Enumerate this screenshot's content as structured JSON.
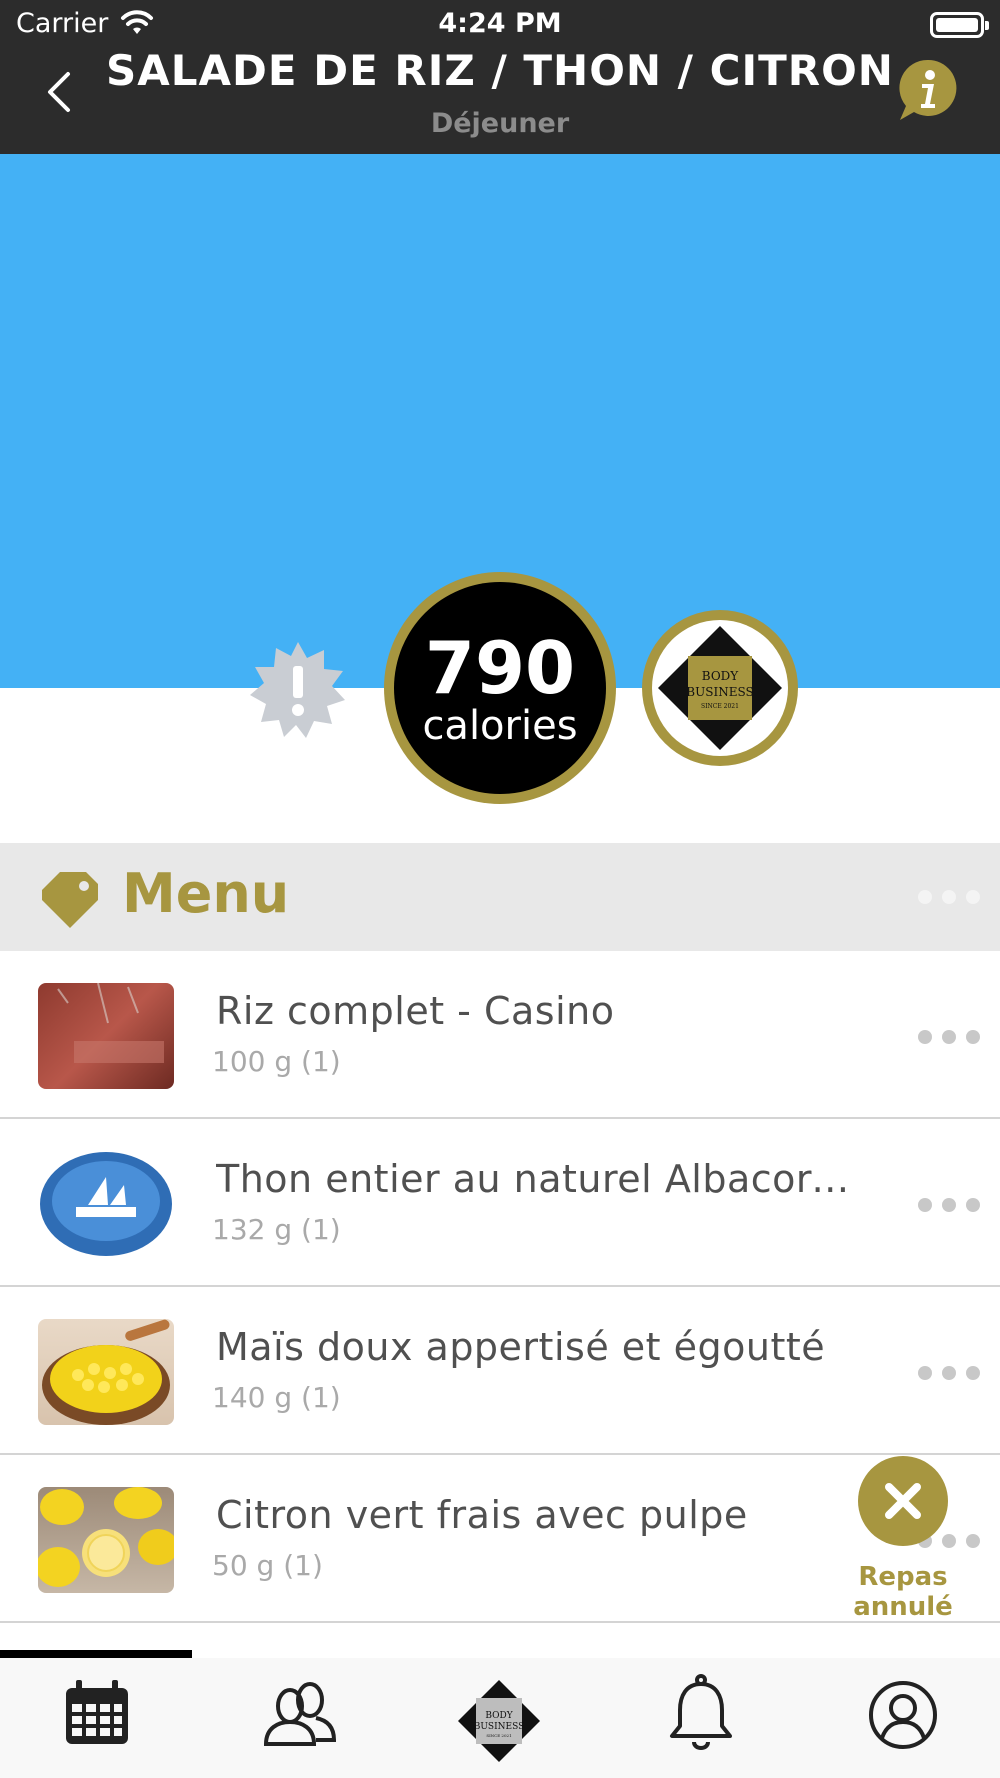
{
  "status_bar": {
    "carrier": "Carrier",
    "time": "4:24 PM"
  },
  "header": {
    "title": "SALADE DE RIZ / THON / CITRON",
    "subtitle": "Déjeuner"
  },
  "hero": {
    "calories_value": "790",
    "calories_unit": "calories",
    "brand_lines": [
      "BODY",
      "BUSINESS",
      "SINCE 2021"
    ]
  },
  "menu": {
    "title": "Menu",
    "items": [
      {
        "name": "Riz complet - Casino",
        "qty": "100 g (1)",
        "thumb_icon": "rice-bag-image"
      },
      {
        "name": "Thon entier au naturel Albacore - Petit Navire",
        "qty": "132 g (1)",
        "thumb_icon": "tuna-can-image"
      },
      {
        "name": "Maïs doux appertisé et égoutté",
        "qty": "140 g (1)",
        "thumb_icon": "corn-bowl-image"
      },
      {
        "name": "Citron vert frais avec pulpe",
        "qty": "50 g (1)",
        "thumb_icon": "lemons-image"
      }
    ]
  },
  "cancel": {
    "label_line1": "Repas",
    "label_line2": "annulé"
  },
  "tabs": [
    {
      "icon": "calendar-icon"
    },
    {
      "icon": "community-icon"
    },
    {
      "icon": "brand-home-icon"
    },
    {
      "icon": "bell-icon"
    },
    {
      "icon": "profile-icon"
    }
  ],
  "colors": {
    "header_bg": "#2c2c2c",
    "hero_bg": "#44b1f5",
    "accent_gold": "#a79640",
    "section_bg": "#e8e8e8"
  }
}
